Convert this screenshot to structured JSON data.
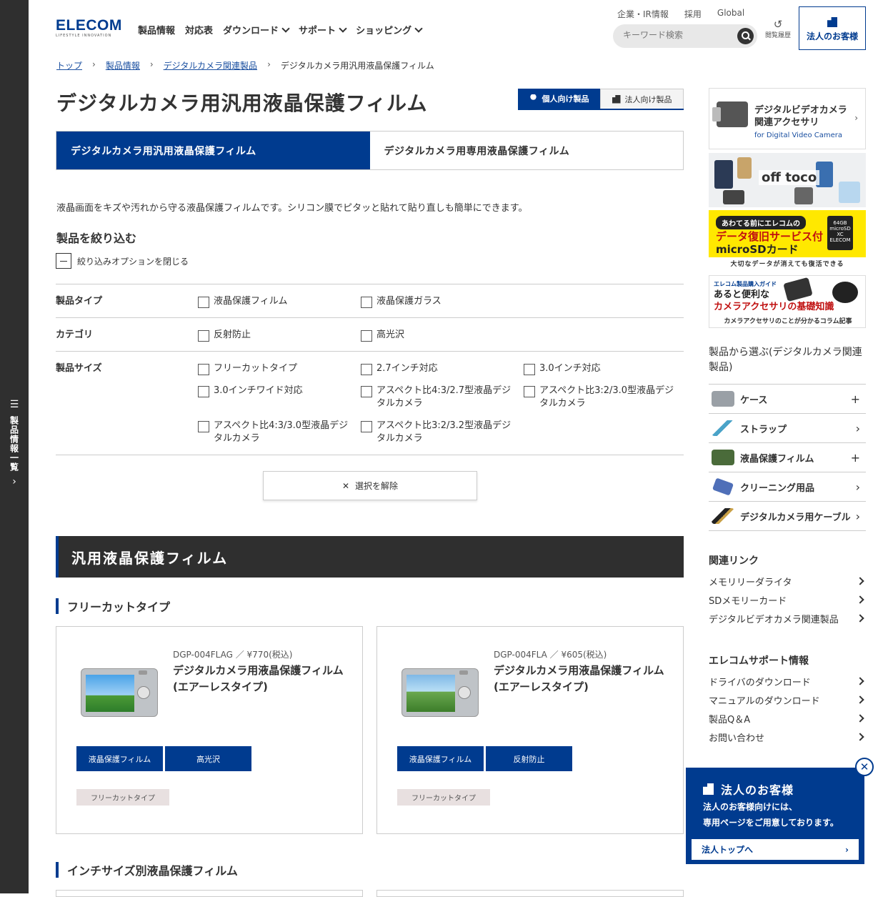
{
  "sidetab": {
    "label": "製品情報一覧"
  },
  "header": {
    "logo_word": "ELECOM",
    "logo_sub": "LIFESTYLE INNOVATION",
    "nav": [
      "製品情報",
      "対応表",
      "ダウンロード",
      "サポート",
      "ショッピング"
    ],
    "top_links": [
      "企業・IR情報",
      "採用",
      "Global"
    ],
    "search_placeholder": "キーワード検索",
    "history": "閲覧履歴",
    "corporate": "法人のお客様"
  },
  "breadcrumb": [
    "トップ",
    "製品情報",
    "デジタルカメラ関連製品",
    "デジタルカメラ用汎用液晶保護フィルム"
  ],
  "page_title": "デジタルカメラ用汎用液晶保護フィルム",
  "segment": {
    "personal": "個人向け製品",
    "business": "法人向け製品"
  },
  "tabs": [
    "デジタルカメラ用汎用液晶保護フィルム",
    "デジタルカメラ用専用液晶保護フィルム"
  ],
  "description": "液晶画面をキズや汚れから守る液晶保護フィルムです。シリコン膜でピタッと貼れて貼り直しも簡単にできます。",
  "filter": {
    "heading": "製品を絞り込む",
    "toggle": "絞り込みオプションを閉じる",
    "rows": [
      {
        "label": "製品タイプ",
        "options": [
          "液晶保護フィルム",
          "液晶保護ガラス"
        ]
      },
      {
        "label": "カテゴリ",
        "options": [
          "反射防止",
          "高光沢"
        ]
      },
      {
        "label": "製品サイズ",
        "options": [
          "フリーカットタイプ",
          "2.7インチ対応",
          "3.0インチ対応",
          "3.0インチワイド対応",
          "アスペクト比4:3/2.7型液晶デジタルカメラ",
          "アスペクト比3:2/3.0型液晶デジタルカメラ",
          "アスペクト比4:3/3.0型液晶デジタルカメラ",
          "アスペクト比3:2/3.2型液晶デジタルカメラ"
        ]
      }
    ],
    "clear": "選択を解除"
  },
  "section_title": "汎用液晶保護フィルム",
  "subsections": [
    "フリーカットタイプ",
    "インチサイズ別液晶保護フィルム"
  ],
  "products": [
    {
      "sku": "DGP-004FLAG ／ ¥770(税込)",
      "name": "デジタルカメラ用液晶保護フィルム",
      "subtitle": "(エアーレスタイプ)",
      "tags": [
        "液晶保護フィルム",
        "高光沢"
      ],
      "size": "フリーカットタイプ"
    },
    {
      "sku": "DGP-004FLA ／ ¥605(税込)",
      "name": "デジタルカメラ用液晶保護フィルム",
      "subtitle": "(エアーレスタイプ)",
      "tags": [
        "液晶保護フィルム",
        "反射防止"
      ],
      "size": "フリーカットタイプ"
    }
  ],
  "sidebar": {
    "video_card": {
      "title": "デジタルビデオカメラ関連アクセサリ",
      "sub": "for Digital Video Camera"
    },
    "banner1": "off toco",
    "banner2": {
      "r1": "あわてる前にエレコムの",
      "r2a": "データ復旧サービス付",
      "r2b": "microSDカード",
      "r3": "大切なデータが消えても復活できる",
      "card": "64GB microSD XC ELECOM"
    },
    "banner3": {
      "r1": "エレコム製品購入ガイド",
      "r2a": "あると便利な",
      "r2b": "カメラアクセサリの基礎知識",
      "r3": "カメラアクセサリのことが分かるコラム記事"
    },
    "cat_heading": "製品から選ぶ(デジタルカメラ関連製品)",
    "categories": [
      {
        "label": "ケース",
        "mark": "+"
      },
      {
        "label": "ストラップ",
        "mark": "›"
      },
      {
        "label": "液晶保護フィルム",
        "mark": "+"
      },
      {
        "label": "クリーニング用品",
        "mark": "›"
      },
      {
        "label": "デジタルカメラ用ケーブル",
        "mark": "›"
      }
    ],
    "related_heading": "関連リンク",
    "related": [
      "メモリリーダライタ",
      "SDメモリーカード",
      "デジタルビデオカメラ関連製品"
    ],
    "support_heading": "エレコムサポート情報",
    "support": [
      "ドライバのダウンロード",
      "マニュアルのダウンロード",
      "製品Q＆A",
      "お問い合わせ"
    ]
  },
  "popup": {
    "title": "法人のお客様",
    "text1": "法人のお客様向けには、",
    "text2": "専用ページをご用意しております。",
    "link": "法人トップへ"
  }
}
